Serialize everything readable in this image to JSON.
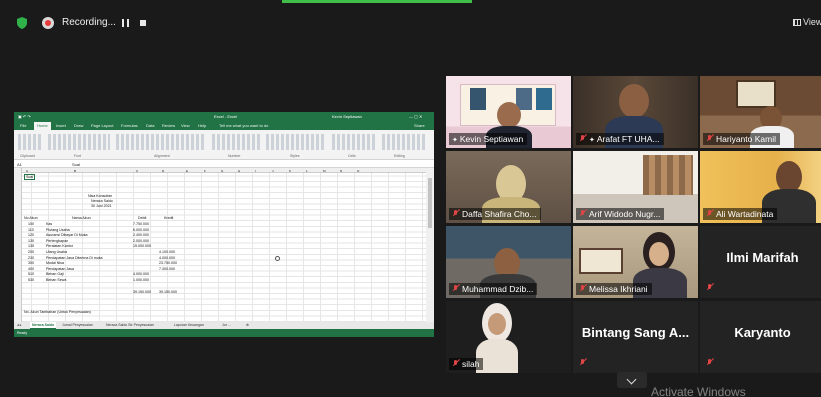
{
  "recording": {
    "label": "Recording..."
  },
  "view_button": {
    "label": "View"
  },
  "colors": {
    "accent_green": "#3fbf4a",
    "excel_green": "#217346",
    "speaker_highlight": "#f0d81c",
    "muted_red": "#e04545"
  },
  "excel": {
    "window_title": "Excel - Excel",
    "user": "Kevin Septiawan",
    "menu_tabs": [
      "File",
      "Home",
      "Insert",
      "Draw",
      "Page Layout",
      "Formulas",
      "Data",
      "Review",
      "View",
      "Help"
    ],
    "tell_me": "Tell me what you want to do",
    "share": "Share",
    "ribbon_groups": [
      "Clipboard",
      "Font",
      "Alignment",
      "Number",
      "Styles",
      "Cells",
      "Editing"
    ],
    "name_box": "A1",
    "formula_value": "Soal",
    "column_letters": [
      "A",
      "B",
      "C",
      "D",
      "E",
      "F",
      "G",
      "H",
      "I",
      "J",
      "K",
      "L",
      "M",
      "N",
      "O"
    ],
    "a1": "Soal",
    "heading_lines": [
      "Nisa Konsultan",
      "Neraca Saldo",
      "30 Juni 2021"
    ],
    "table_header": {
      "no": "No Akun",
      "name": "Nama Akun",
      "debit": "Debit",
      "kredit": "Kredit"
    },
    "rows": [
      {
        "no": "100",
        "name": "Kas",
        "debit": "7.750.000",
        "kredit": ""
      },
      {
        "no": "110",
        "name": "Piutang Usaha",
        "debit": "6.000.000",
        "kredit": ""
      },
      {
        "no": "120",
        "name": "Asuransi Dibayar Di Muka",
        "debit": "2.400.000",
        "kredit": ""
      },
      {
        "no": "130",
        "name": "Perlengkapan",
        "debit": "2.000.000",
        "kredit": ""
      },
      {
        "no": "135",
        "name": "Peralatan Kantor",
        "debit": "15.000.000",
        "kredit": ""
      },
      {
        "no": "200",
        "name": "Utang Usaha",
        "debit": "",
        "kredit": "4.100.000"
      },
      {
        "no": "230",
        "name": "Pendapatan Jasa Diterima Di muka",
        "debit": "",
        "kredit": "4.000.000"
      },
      {
        "no": "300",
        "name": "Modal Nisa",
        "debit": "",
        "kredit": "23.750.000"
      },
      {
        "no": "400",
        "name": "Pendapatan Jasa",
        "debit": "",
        "kredit": "7.300.000"
      },
      {
        "no": "510",
        "name": "Beban Gaji",
        "debit": "4.000.000",
        "kredit": ""
      },
      {
        "no": "530",
        "name": "Beban Sewa",
        "debit": "1.000.000",
        "kredit": ""
      }
    ],
    "totals": {
      "debit": "39.150.000",
      "kredit": "39.150.000"
    },
    "footer_note": "No. Akun Tambahan (Untuk Penyesuaian)",
    "sheet_tabs": [
      "Neraca Saldo",
      "Jurnal Penyesuaian",
      "Neraca Saldo Str Penyesuaian",
      "Laporan Keuangan",
      "Jur ..."
    ],
    "status_ready": "Ready"
  },
  "participants": [
    {
      "name": "Kevin Septiawan",
      "muted": false,
      "highlight": true,
      "type": "video"
    },
    {
      "name": "Arafat FT UHA...",
      "muted": true,
      "highlight": false,
      "type": "video"
    },
    {
      "name": "Hariyanto Kamil",
      "muted": true,
      "highlight": false,
      "type": "video"
    },
    {
      "name": "Daffa Shafira Cho...",
      "muted": true,
      "highlight": false,
      "type": "video"
    },
    {
      "name": "Arif Widodo Nugr...",
      "muted": true,
      "highlight": false,
      "type": "video"
    },
    {
      "name": "Ali Wartadinata",
      "muted": true,
      "highlight": false,
      "type": "video"
    },
    {
      "name": "Muhammad Dzib...",
      "muted": true,
      "highlight": false,
      "type": "video"
    },
    {
      "name": "Melissa Ikhriani",
      "muted": true,
      "highlight": false,
      "type": "video"
    },
    {
      "name": "Ilmi Marifah",
      "muted": true,
      "highlight": false,
      "type": "name"
    },
    {
      "name": "silah",
      "muted": true,
      "highlight": false,
      "type": "video"
    },
    {
      "name": "Bintang Sang A...",
      "muted": true,
      "highlight": false,
      "type": "name"
    },
    {
      "name": "Karyanto",
      "muted": true,
      "highlight": false,
      "type": "name"
    }
  ],
  "watermark": "Activate Windows"
}
